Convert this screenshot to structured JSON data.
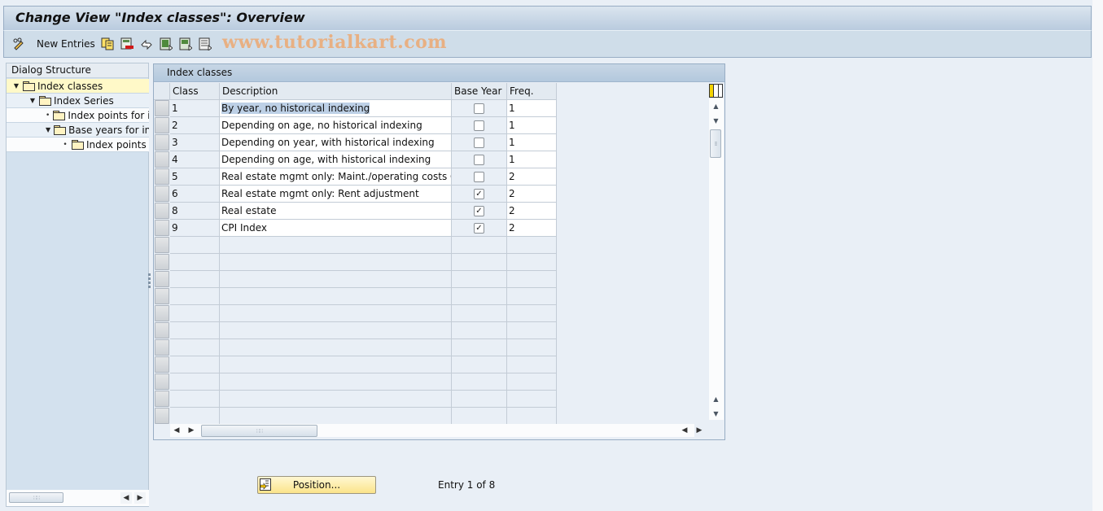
{
  "window": {
    "title": "Change View \"Index classes\": Overview"
  },
  "toolbar": {
    "new_entries_label": "New Entries",
    "watermark": "www.tutorialkart.com",
    "icons": [
      "change-display-icon",
      "copy-as-icon",
      "delete-icon",
      "undo-change-icon",
      "select-all-icon",
      "select-block-icon",
      "deselect-all-icon"
    ]
  },
  "dialog_structure": {
    "header": "Dialog Structure",
    "items": [
      {
        "label": "Index classes",
        "level": 0,
        "expander": "expanded",
        "selected": true
      },
      {
        "label": "Index Series",
        "level": 1,
        "expander": "expanded",
        "selected": false
      },
      {
        "label": "Index points for i",
        "level": 2,
        "expander": "leaf",
        "selected": false
      },
      {
        "label": "Base years for inc",
        "level": 2,
        "expander": "expanded",
        "selected": false
      },
      {
        "label": "Index points",
        "level": 3,
        "expander": "leaf",
        "selected": false
      }
    ]
  },
  "table": {
    "title": "Index classes",
    "columns": [
      "Class",
      "Description",
      "Base Year",
      "Freq."
    ],
    "rows": [
      {
        "class": "1",
        "description": "By year, no historical indexing",
        "base_year": false,
        "freq": "1"
      },
      {
        "class": "2",
        "description": "Depending on age, no historical indexing",
        "base_year": false,
        "freq": "1"
      },
      {
        "class": "3",
        "description": "Depending on year, with historical indexing",
        "base_year": false,
        "freq": "1"
      },
      {
        "class": "4",
        "description": "Depending on age, with historical indexing",
        "base_year": false,
        "freq": "1"
      },
      {
        "class": "5",
        "description": "Real estate mgmt only: Maint./operating costs  CH",
        "base_year": false,
        "freq": "2"
      },
      {
        "class": "6",
        "description": "Real estate mgmt only: Rent adjustment",
        "base_year": true,
        "freq": "2"
      },
      {
        "class": "8",
        "description": "Real estate",
        "base_year": true,
        "freq": "2"
      },
      {
        "class": "9",
        "description": "CPI Index",
        "base_year": true,
        "freq": "2"
      }
    ],
    "empty_rows": 11
  },
  "footer": {
    "position_button": "Position...",
    "entry_info": "Entry 1 of 8"
  }
}
